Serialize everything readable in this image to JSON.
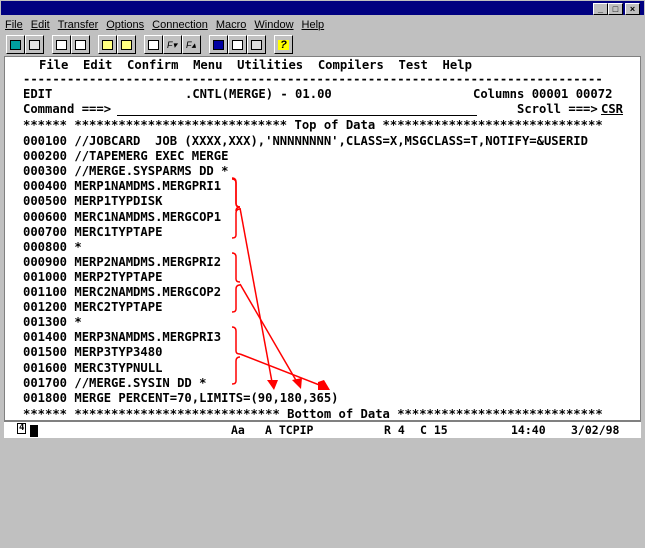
{
  "window": {
    "controls": [
      "_",
      "□",
      "×"
    ]
  },
  "menu": [
    "File",
    "Edit",
    "Transfer",
    "Options",
    "Connection",
    "Macro",
    "Window",
    "Help"
  ],
  "toolbar": [
    "display-icon",
    "printer-icon",
    "copy-icon",
    "paste-icon",
    "send-icon",
    "receive-icon",
    "print-screen-icon",
    "font-down-icon",
    "font-up-icon",
    "info-icon",
    "edit-icon",
    "keyboard-icon",
    "help-icon"
  ],
  "ispf": {
    "menu": "File  Edit  Confirm  Menu  Utilities  Compilers  Test  Help",
    "divider": "-------------------------------------------------------------------------------",
    "header_left": "EDIT",
    "header_title": ".CNTL(MERGE) - 01.00",
    "header_right": "Columns 00001 00072",
    "command_label": "Command ===>",
    "scroll_label": "Scroll ===>",
    "scroll_value": "CSR",
    "top": "****** ***************************** Top of Data ******************************",
    "lines": [
      "000100 //JOBCARD  JOB (XXXX,XXX),'NNNNNNNN',CLASS=X,MSGCLASS=T,NOTIFY=&USERID",
      "000200 //TAPEMERG EXEC MERGE",
      "000300 //MERGE.SYSPARMS DD *",
      "000400 MERP1NAMDMS.MERGPRI1",
      "000500 MERP1TYPDISK",
      "000600 MERC1NAMDMS.MERGCOP1",
      "000700 MERC1TYPTAPE",
      "000800 *",
      "000900 MERP2NAMDMS.MERGPRI2",
      "001000 MERP2TYPTAPE",
      "001100 MERC2NAMDMS.MERGCOP2",
      "001200 MERC2TYPTAPE",
      "001300 *",
      "001400 MERP3NAMDMS.MERGPRI3",
      "001500 MERP3TYP3480",
      "001600 MERC3TYPNULL",
      "001700 //MERGE.SYSIN DD *",
      "001800 MERGE PERCENT=70,LIMITS=(90,180,365)"
    ],
    "bottom": "****** **************************** Bottom of Data ****************************"
  },
  "status": {
    "session": "4",
    "case": "Aa",
    "conn": "A TCPIP",
    "row": "R 4",
    "col": "C 15",
    "time": "14:40",
    "date": "3/02/98"
  },
  "colors": {
    "title": "#000080",
    "annotation": "#ff0000"
  }
}
